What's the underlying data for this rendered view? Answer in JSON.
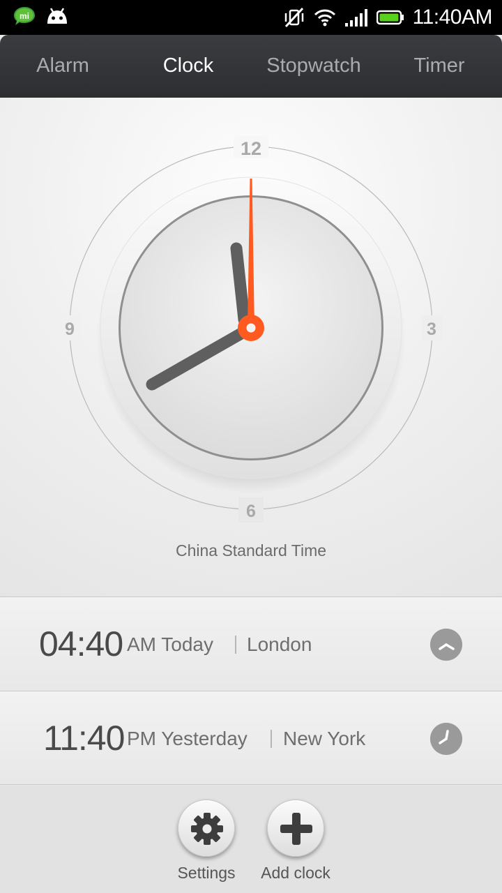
{
  "status_bar": {
    "time": "11:40AM",
    "icons": [
      "mi-talk-icon",
      "android-icon",
      "vibrate-mute-icon",
      "wifi-icon",
      "signal-icon",
      "battery-icon"
    ]
  },
  "tabs": [
    {
      "label": "Alarm",
      "active": false
    },
    {
      "label": "Clock",
      "active": true
    },
    {
      "label": "Stopwatch",
      "active": false
    },
    {
      "label": "Timer",
      "active": false
    }
  ],
  "clock": {
    "time": "11:40",
    "dial_labels": {
      "twelve": "12",
      "three": "3",
      "six": "6",
      "nine": "9"
    },
    "timezone": "China Standard Time",
    "accent_color": "#ff5a1f"
  },
  "world_clocks": [
    {
      "time": "04:40",
      "period_day": "AM Today",
      "city": "London",
      "icon": "clock-icon"
    },
    {
      "time": "11:40",
      "period_day": "PM Yesterday",
      "city": "New York",
      "icon": "clock-icon"
    }
  ],
  "actions": {
    "settings_label": "Settings",
    "add_clock_label": "Add clock"
  }
}
